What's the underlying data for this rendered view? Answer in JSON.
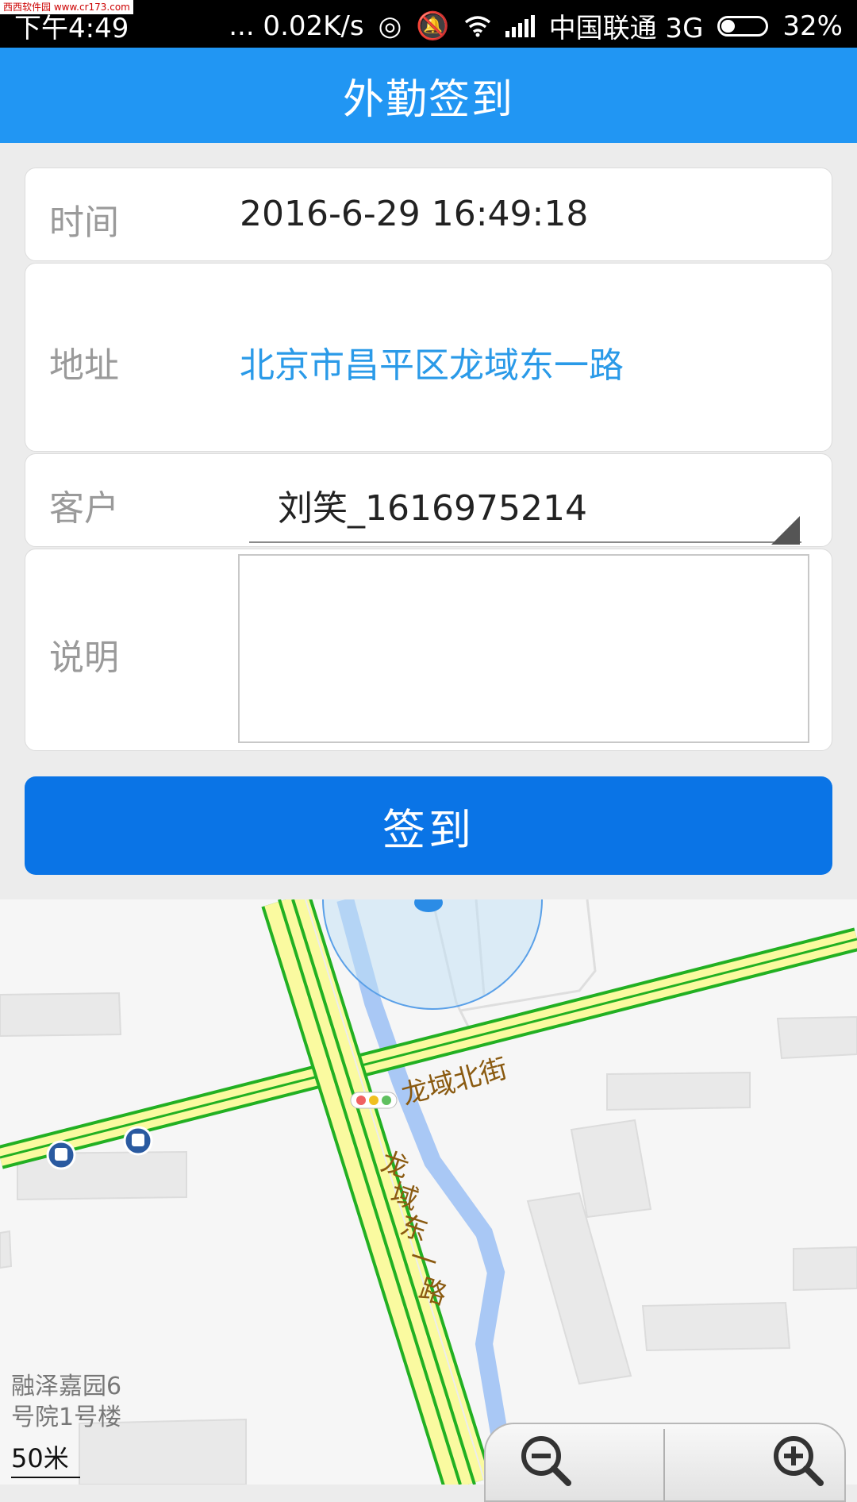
{
  "status_bar": {
    "watermark": "西西软件园 www.cr173.com",
    "time": "下午4:49",
    "net_speed": "... 0.02K/s",
    "carrier": "中国联通 3G",
    "battery": "32%",
    "battery_level": 0.32
  },
  "header": {
    "title": "外勤签到"
  },
  "form": {
    "time_label": "时间",
    "time_value": "2016-6-29 16:49:18",
    "address_label": "地址",
    "address_value": "北京市昌平区龙域东一路",
    "customer_label": "客户",
    "customer_value": "刘笑_1616975214",
    "note_label": "说明",
    "note_value": ""
  },
  "signin_button": {
    "label": "签到"
  },
  "map": {
    "road_north": "龙域北街",
    "road_east_1": "龙域东一路",
    "building_line1": "融泽嘉园6",
    "building_line2": "号院1号楼",
    "scale": "50米"
  },
  "colors": {
    "header": "#2196f3",
    "button": "#0a74e6",
    "address_text": "#2a9ae8",
    "road_green": "#22b022",
    "road_fill": "#fafaa0"
  },
  "icons": [
    "wifi-icon",
    "signal-icon",
    "battery-icon",
    "mute-icon",
    "location-dot-icon",
    "bus-stop-icon",
    "traffic-light-icon",
    "zoom-out-icon",
    "zoom-in-icon"
  ]
}
